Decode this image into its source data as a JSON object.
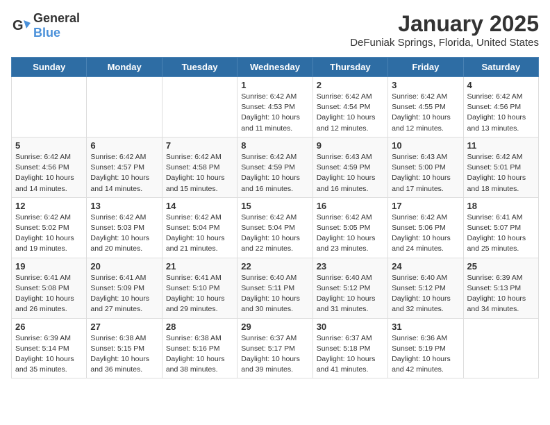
{
  "logo": {
    "general": "General",
    "blue": "Blue"
  },
  "header": {
    "month": "January 2025",
    "location": "DeFuniak Springs, Florida, United States"
  },
  "weekdays": [
    "Sunday",
    "Monday",
    "Tuesday",
    "Wednesday",
    "Thursday",
    "Friday",
    "Saturday"
  ],
  "weeks": [
    [
      {
        "day": "",
        "info": ""
      },
      {
        "day": "",
        "info": ""
      },
      {
        "day": "",
        "info": ""
      },
      {
        "day": "1",
        "info": "Sunrise: 6:42 AM\nSunset: 4:53 PM\nDaylight: 10 hours\nand 11 minutes."
      },
      {
        "day": "2",
        "info": "Sunrise: 6:42 AM\nSunset: 4:54 PM\nDaylight: 10 hours\nand 12 minutes."
      },
      {
        "day": "3",
        "info": "Sunrise: 6:42 AM\nSunset: 4:55 PM\nDaylight: 10 hours\nand 12 minutes."
      },
      {
        "day": "4",
        "info": "Sunrise: 6:42 AM\nSunset: 4:56 PM\nDaylight: 10 hours\nand 13 minutes."
      }
    ],
    [
      {
        "day": "5",
        "info": "Sunrise: 6:42 AM\nSunset: 4:56 PM\nDaylight: 10 hours\nand 14 minutes."
      },
      {
        "day": "6",
        "info": "Sunrise: 6:42 AM\nSunset: 4:57 PM\nDaylight: 10 hours\nand 14 minutes."
      },
      {
        "day": "7",
        "info": "Sunrise: 6:42 AM\nSunset: 4:58 PM\nDaylight: 10 hours\nand 15 minutes."
      },
      {
        "day": "8",
        "info": "Sunrise: 6:42 AM\nSunset: 4:59 PM\nDaylight: 10 hours\nand 16 minutes."
      },
      {
        "day": "9",
        "info": "Sunrise: 6:43 AM\nSunset: 4:59 PM\nDaylight: 10 hours\nand 16 minutes."
      },
      {
        "day": "10",
        "info": "Sunrise: 6:43 AM\nSunset: 5:00 PM\nDaylight: 10 hours\nand 17 minutes."
      },
      {
        "day": "11",
        "info": "Sunrise: 6:42 AM\nSunset: 5:01 PM\nDaylight: 10 hours\nand 18 minutes."
      }
    ],
    [
      {
        "day": "12",
        "info": "Sunrise: 6:42 AM\nSunset: 5:02 PM\nDaylight: 10 hours\nand 19 minutes."
      },
      {
        "day": "13",
        "info": "Sunrise: 6:42 AM\nSunset: 5:03 PM\nDaylight: 10 hours\nand 20 minutes."
      },
      {
        "day": "14",
        "info": "Sunrise: 6:42 AM\nSunset: 5:04 PM\nDaylight: 10 hours\nand 21 minutes."
      },
      {
        "day": "15",
        "info": "Sunrise: 6:42 AM\nSunset: 5:04 PM\nDaylight: 10 hours\nand 22 minutes."
      },
      {
        "day": "16",
        "info": "Sunrise: 6:42 AM\nSunset: 5:05 PM\nDaylight: 10 hours\nand 23 minutes."
      },
      {
        "day": "17",
        "info": "Sunrise: 6:42 AM\nSunset: 5:06 PM\nDaylight: 10 hours\nand 24 minutes."
      },
      {
        "day": "18",
        "info": "Sunrise: 6:41 AM\nSunset: 5:07 PM\nDaylight: 10 hours\nand 25 minutes."
      }
    ],
    [
      {
        "day": "19",
        "info": "Sunrise: 6:41 AM\nSunset: 5:08 PM\nDaylight: 10 hours\nand 26 minutes."
      },
      {
        "day": "20",
        "info": "Sunrise: 6:41 AM\nSunset: 5:09 PM\nDaylight: 10 hours\nand 27 minutes."
      },
      {
        "day": "21",
        "info": "Sunrise: 6:41 AM\nSunset: 5:10 PM\nDaylight: 10 hours\nand 29 minutes."
      },
      {
        "day": "22",
        "info": "Sunrise: 6:40 AM\nSunset: 5:11 PM\nDaylight: 10 hours\nand 30 minutes."
      },
      {
        "day": "23",
        "info": "Sunrise: 6:40 AM\nSunset: 5:12 PM\nDaylight: 10 hours\nand 31 minutes."
      },
      {
        "day": "24",
        "info": "Sunrise: 6:40 AM\nSunset: 5:12 PM\nDaylight: 10 hours\nand 32 minutes."
      },
      {
        "day": "25",
        "info": "Sunrise: 6:39 AM\nSunset: 5:13 PM\nDaylight: 10 hours\nand 34 minutes."
      }
    ],
    [
      {
        "day": "26",
        "info": "Sunrise: 6:39 AM\nSunset: 5:14 PM\nDaylight: 10 hours\nand 35 minutes."
      },
      {
        "day": "27",
        "info": "Sunrise: 6:38 AM\nSunset: 5:15 PM\nDaylight: 10 hours\nand 36 minutes."
      },
      {
        "day": "28",
        "info": "Sunrise: 6:38 AM\nSunset: 5:16 PM\nDaylight: 10 hours\nand 38 minutes."
      },
      {
        "day": "29",
        "info": "Sunrise: 6:37 AM\nSunset: 5:17 PM\nDaylight: 10 hours\nand 39 minutes."
      },
      {
        "day": "30",
        "info": "Sunrise: 6:37 AM\nSunset: 5:18 PM\nDaylight: 10 hours\nand 41 minutes."
      },
      {
        "day": "31",
        "info": "Sunrise: 6:36 AM\nSunset: 5:19 PM\nDaylight: 10 hours\nand 42 minutes."
      },
      {
        "day": "",
        "info": ""
      }
    ]
  ]
}
